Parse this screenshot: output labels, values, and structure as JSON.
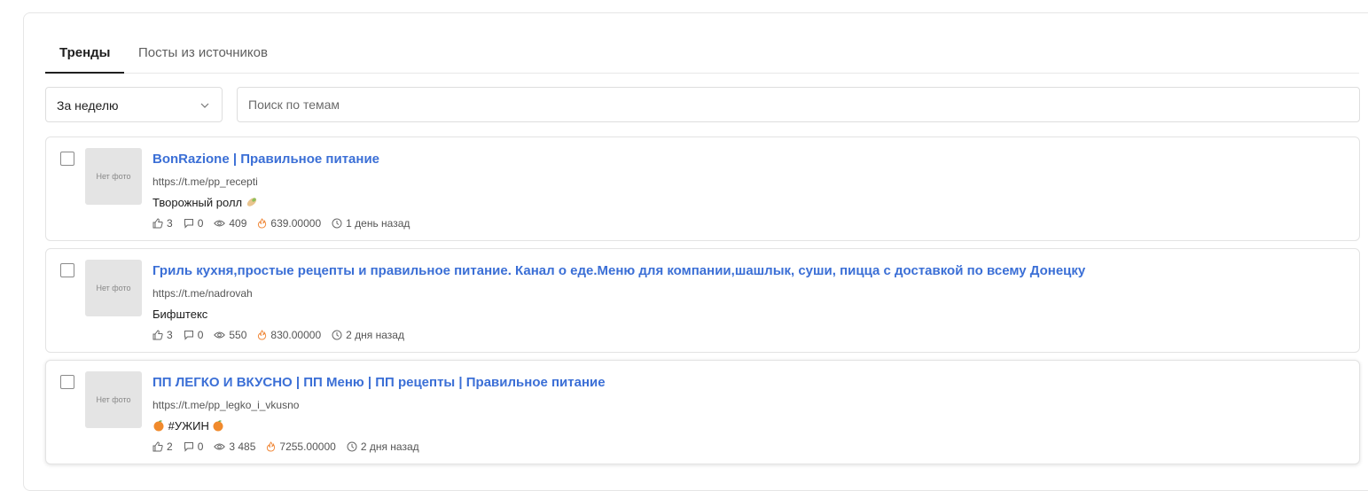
{
  "tabs": [
    {
      "label": "Тренды",
      "active": true
    },
    {
      "label": "Посты из источников",
      "active": false
    }
  ],
  "filters": {
    "period_value": "За неделю",
    "search_placeholder": "Поиск по темам"
  },
  "colors": {
    "link": "#3b6fd6",
    "fire": "#f08a3c"
  },
  "posts": [
    {
      "thumb": "Нет фото",
      "title": "BonRazione | Правильное питание",
      "url": "https://t.me/pp_recepti",
      "text": "Творожный ролл",
      "text_emoji_after": "burrito",
      "likes": "3",
      "comments": "0",
      "views": "409",
      "score": "639.00000",
      "time": "1 день назад"
    },
    {
      "thumb": "Нет фото",
      "title": "Гриль кухня,простые рецепты и правильное питание. Канал о еде.Меню для компании,шашлык, суши, пицца с доставкой по всему Донецку",
      "url": "https://t.me/nadrovah",
      "text": "Бифштекс",
      "likes": "3",
      "comments": "0",
      "views": "550",
      "score": "830.00000",
      "time": "2 дня назад"
    },
    {
      "thumb": "Нет фото",
      "title": "ПП ЛЕГКО И ВКУСНО | ПП Меню | ПП рецепты | Правильное питание",
      "url": "https://t.me/pp_legko_i_vkusno",
      "text": "#УЖИН",
      "text_emoji_around": "tangerine",
      "likes": "2",
      "comments": "0",
      "views": "3 485",
      "score": "7255.00000",
      "time": "2 дня назад"
    }
  ]
}
